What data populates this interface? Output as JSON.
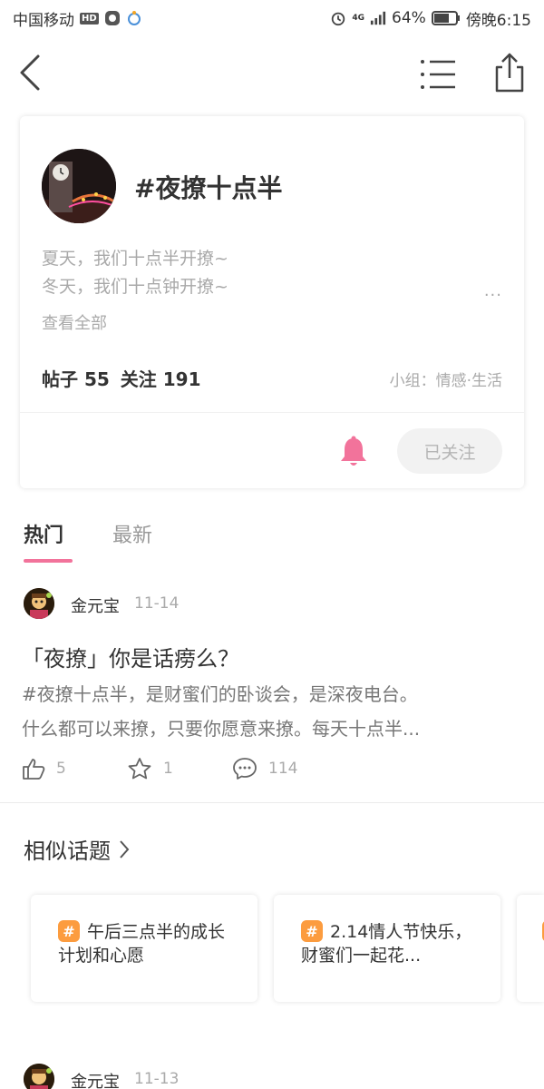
{
  "status_bar": {
    "carrier": "中国移动",
    "hd": "HD",
    "network": "4G",
    "battery": "64%",
    "time": "傍晚6:15"
  },
  "topic": {
    "title": "#夜撩十点半",
    "desc_line1": "夏天，我们十点半开撩~",
    "desc_line2": "冬天，我们十点钟开撩~",
    "more": "...",
    "view_all": "查看全部",
    "posts_label": "帖子 55",
    "follow_label": "关注 191",
    "group": "小组：情感·生活",
    "follow_button": "已关注"
  },
  "tabs": [
    {
      "label": "热门",
      "active": true
    },
    {
      "label": "最新",
      "active": false
    }
  ],
  "post": {
    "author": "金元宝",
    "date": "11-14",
    "title": "「夜撩」你是话痨么？",
    "body_line1": "#夜撩十点半，是财蜜们的卧谈会，是深夜电台。",
    "body_line2": "什么都可以来撩，只要你愿意来撩。每天十点半...",
    "likes": "5",
    "stars": "1",
    "comments": "114"
  },
  "similar": {
    "title": "相似话题",
    "items": [
      {
        "text": "午后三点半的成长计划和心愿"
      },
      {
        "text": "2.14情人节快乐，财蜜们一起花..."
      }
    ]
  },
  "next_post": {
    "author": "金元宝",
    "date": "11-13"
  },
  "colors": {
    "accent_pink": "#f2739b",
    "hash_orange": "#fc9c3f"
  }
}
